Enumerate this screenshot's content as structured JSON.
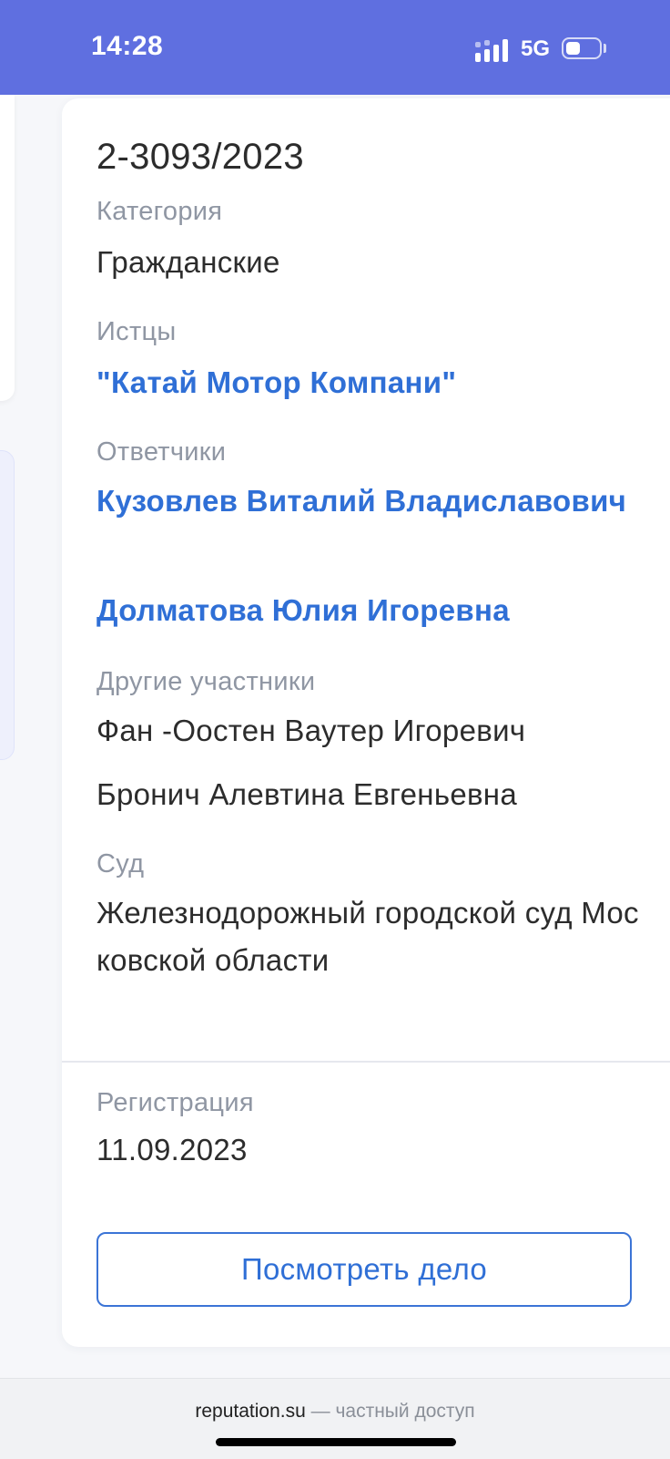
{
  "status_bar": {
    "time": "14:28",
    "network": "5G",
    "battery_level": 0.45,
    "signal_icon": "signal-bars-icon",
    "battery_icon": "battery-icon"
  },
  "colors": {
    "status_bar_bg": "#5f6fe0",
    "link": "#2f6fd6",
    "label": "#8f96a3",
    "text": "#2c2c2c"
  },
  "case": {
    "number": "2-3093/2023",
    "category_label": "Категория",
    "category": "Гражданские",
    "plaintiffs_label": "Истцы",
    "plaintiffs": [
      "\"Катай Мотор Компани\""
    ],
    "defendants_label": "Ответчики",
    "defendants": [
      "Кузовлев Виталий Владиславович",
      "Долматова Юлия Игоревна"
    ],
    "others_label": "Другие участники",
    "others": [
      "Фан -Оостен Ваутер Игоревич",
      "Бронич Алевтина Евгеньевна"
    ],
    "court_label": "Суд",
    "court": "Железнодорожный городской суд Московской области",
    "registration_label": "Регистрация",
    "registration_date": "11.09.2023",
    "view_button_label": "Посмотреть дело"
  },
  "footer": {
    "domain": "reputation.su",
    "note": " — частный доступ"
  }
}
